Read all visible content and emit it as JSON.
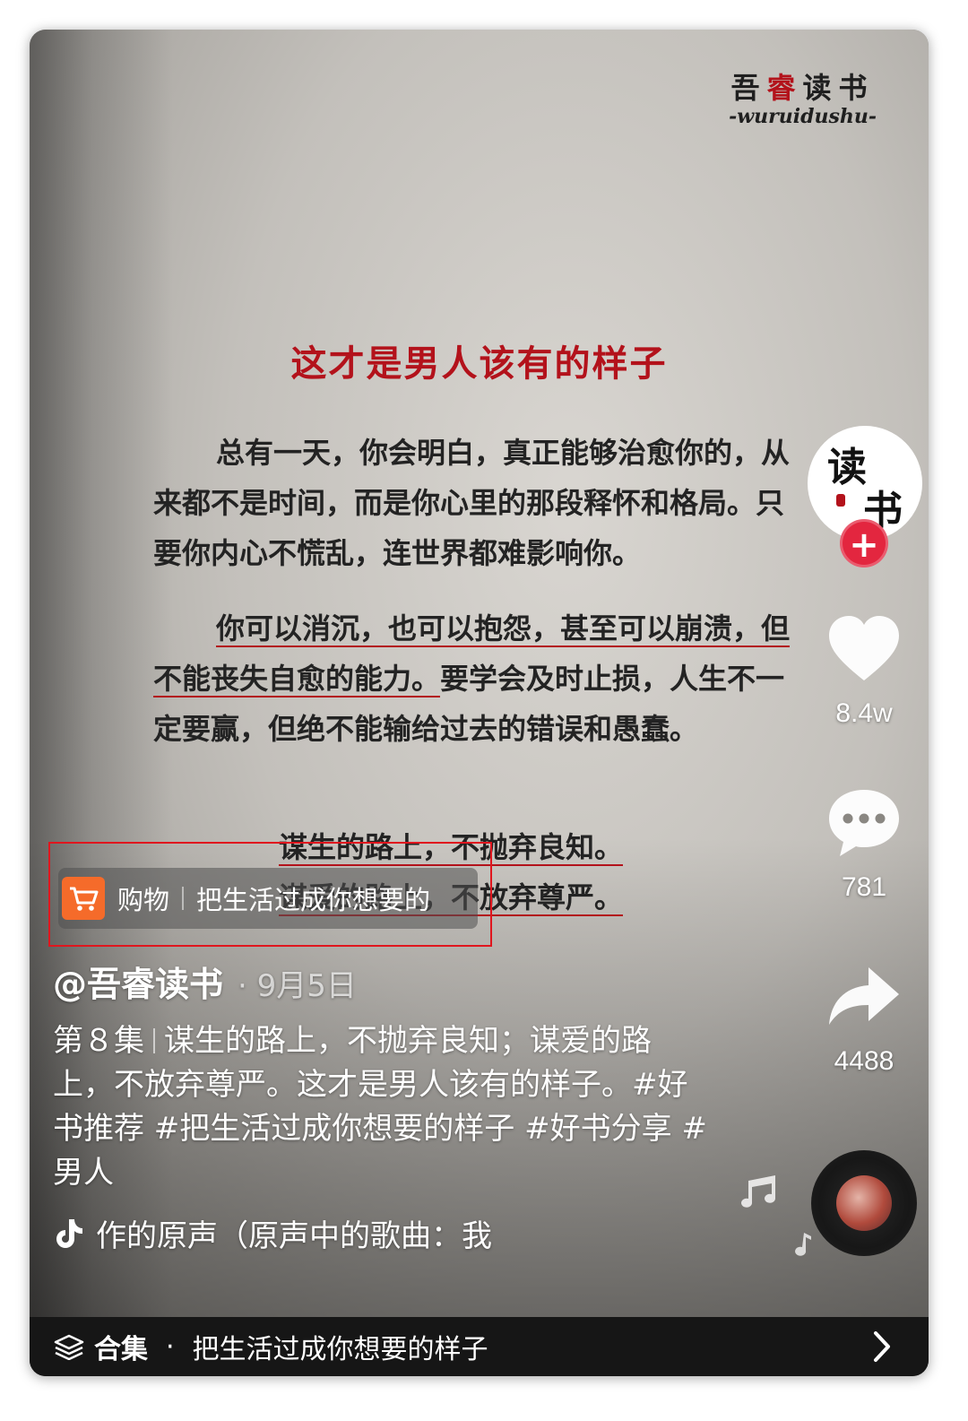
{
  "logo": {
    "cn_prefix": "吾",
    "cn_red": "睿",
    "cn_suffix": "读书",
    "en": "-wuruidushu-"
  },
  "article": {
    "title": "这才是男人该有的样子",
    "p1": "总有一天，你会明白，真正能够治愈你的，从来都不是时间，而是你心里的那段释怀和格局。只要你内心不慌乱，连世界都难影响你。",
    "p2_underlined": "你可以消沉，也可以抱怨，甚至可以崩溃，但不能丧失自愈的能力。",
    "p2_rest": "要学会及时止损，人生不一定要赢，但绝不能输给过去的错误和愚蠢。",
    "line1": "谋生的路上，不抛弃良知。",
    "line2": "谋爱的路上，不放弃尊严。"
  },
  "avatar": {
    "glyph1": "读",
    "glyph2": "书",
    "follow": "+"
  },
  "actions": {
    "likes": "8.4w",
    "comments": "781",
    "shares": "4488"
  },
  "shop": {
    "label": "购物",
    "text": "把生活过成你想要的"
  },
  "post": {
    "author": "@吾睿读书",
    "date": "· 9月5日",
    "episode": "第８集",
    "caption": "谋生的路上，不抛弃良知；谋爱的路上，不放弃尊严。这才是男人该有的样子。#好书推荐 #把生活过成你想要的样子 #好书分享 #男人",
    "music": "作的原声（原声中的歌曲：我"
  },
  "collection": {
    "label": "合集",
    "dot": "·",
    "title": "把生活过成你想要的样子"
  },
  "colors": {
    "accent_red": "#b3121b",
    "follow_red": "#e3263f",
    "shop_orange": "#f56b2a",
    "highlight_box": "#e0161e"
  }
}
